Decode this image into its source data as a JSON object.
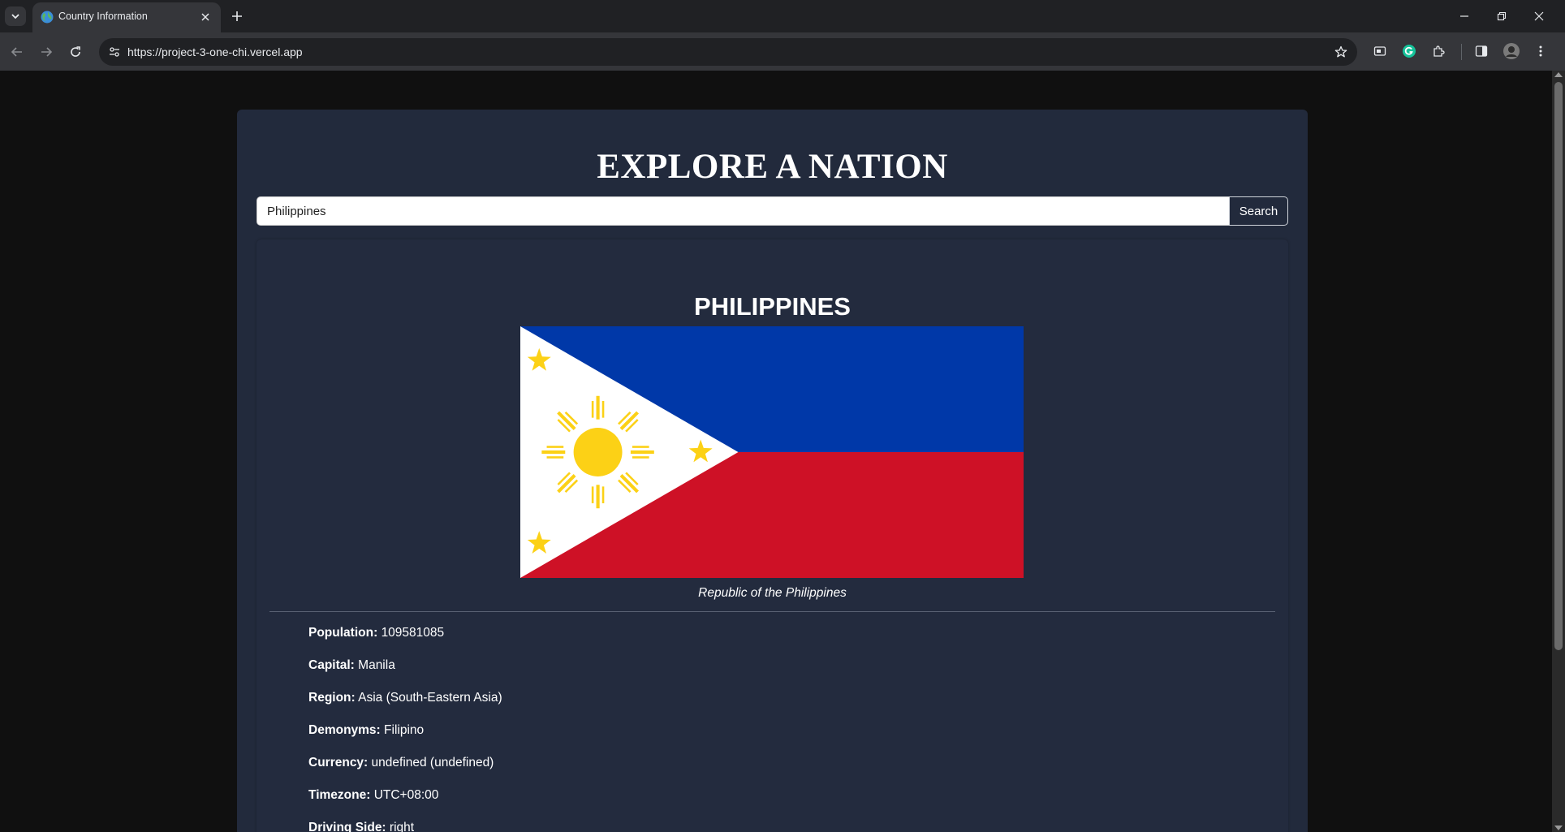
{
  "browser": {
    "tab_title": "Country Information",
    "url": "https://project-3-one-chi.vercel.app"
  },
  "page": {
    "heading": "EXPLORE A NATION",
    "search": {
      "value": "Philippines",
      "button_label": "Search"
    },
    "country": {
      "name": "PHILIPPINES",
      "official_name": "Republic of the Philippines",
      "flag_colors": {
        "blue": "#0038a8",
        "red": "#ce1126",
        "white": "#ffffff",
        "gold": "#fcd116"
      },
      "details": [
        {
          "label": "Population:",
          "value": "109581085"
        },
        {
          "label": "Capital:",
          "value": "Manila"
        },
        {
          "label": "Region:",
          "value": "Asia (South-Eastern Asia)"
        },
        {
          "label": "Demonyms:",
          "value": "Filipino"
        },
        {
          "label": "Currency:",
          "value": "undefined (undefined)"
        },
        {
          "label": "Timezone:",
          "value": "UTC+08:00"
        },
        {
          "label": "Driving Side:",
          "value": "right"
        }
      ]
    }
  },
  "colors": {
    "page_bg": "#101010",
    "container_bg": "#222a3c",
    "chrome_dark": "#202124",
    "chrome_toolbar": "#35363a"
  },
  "icons": [
    "tab-list-icon",
    "globe-favicon",
    "close-icon",
    "plus-icon",
    "minimize-icon",
    "restore-icon",
    "back-icon",
    "forward-icon",
    "reload-icon",
    "site-info-icon",
    "star-icon",
    "media-icon",
    "grammarly-icon",
    "extensions-icon",
    "side-panel-icon",
    "profile-avatar",
    "menu-icon"
  ]
}
